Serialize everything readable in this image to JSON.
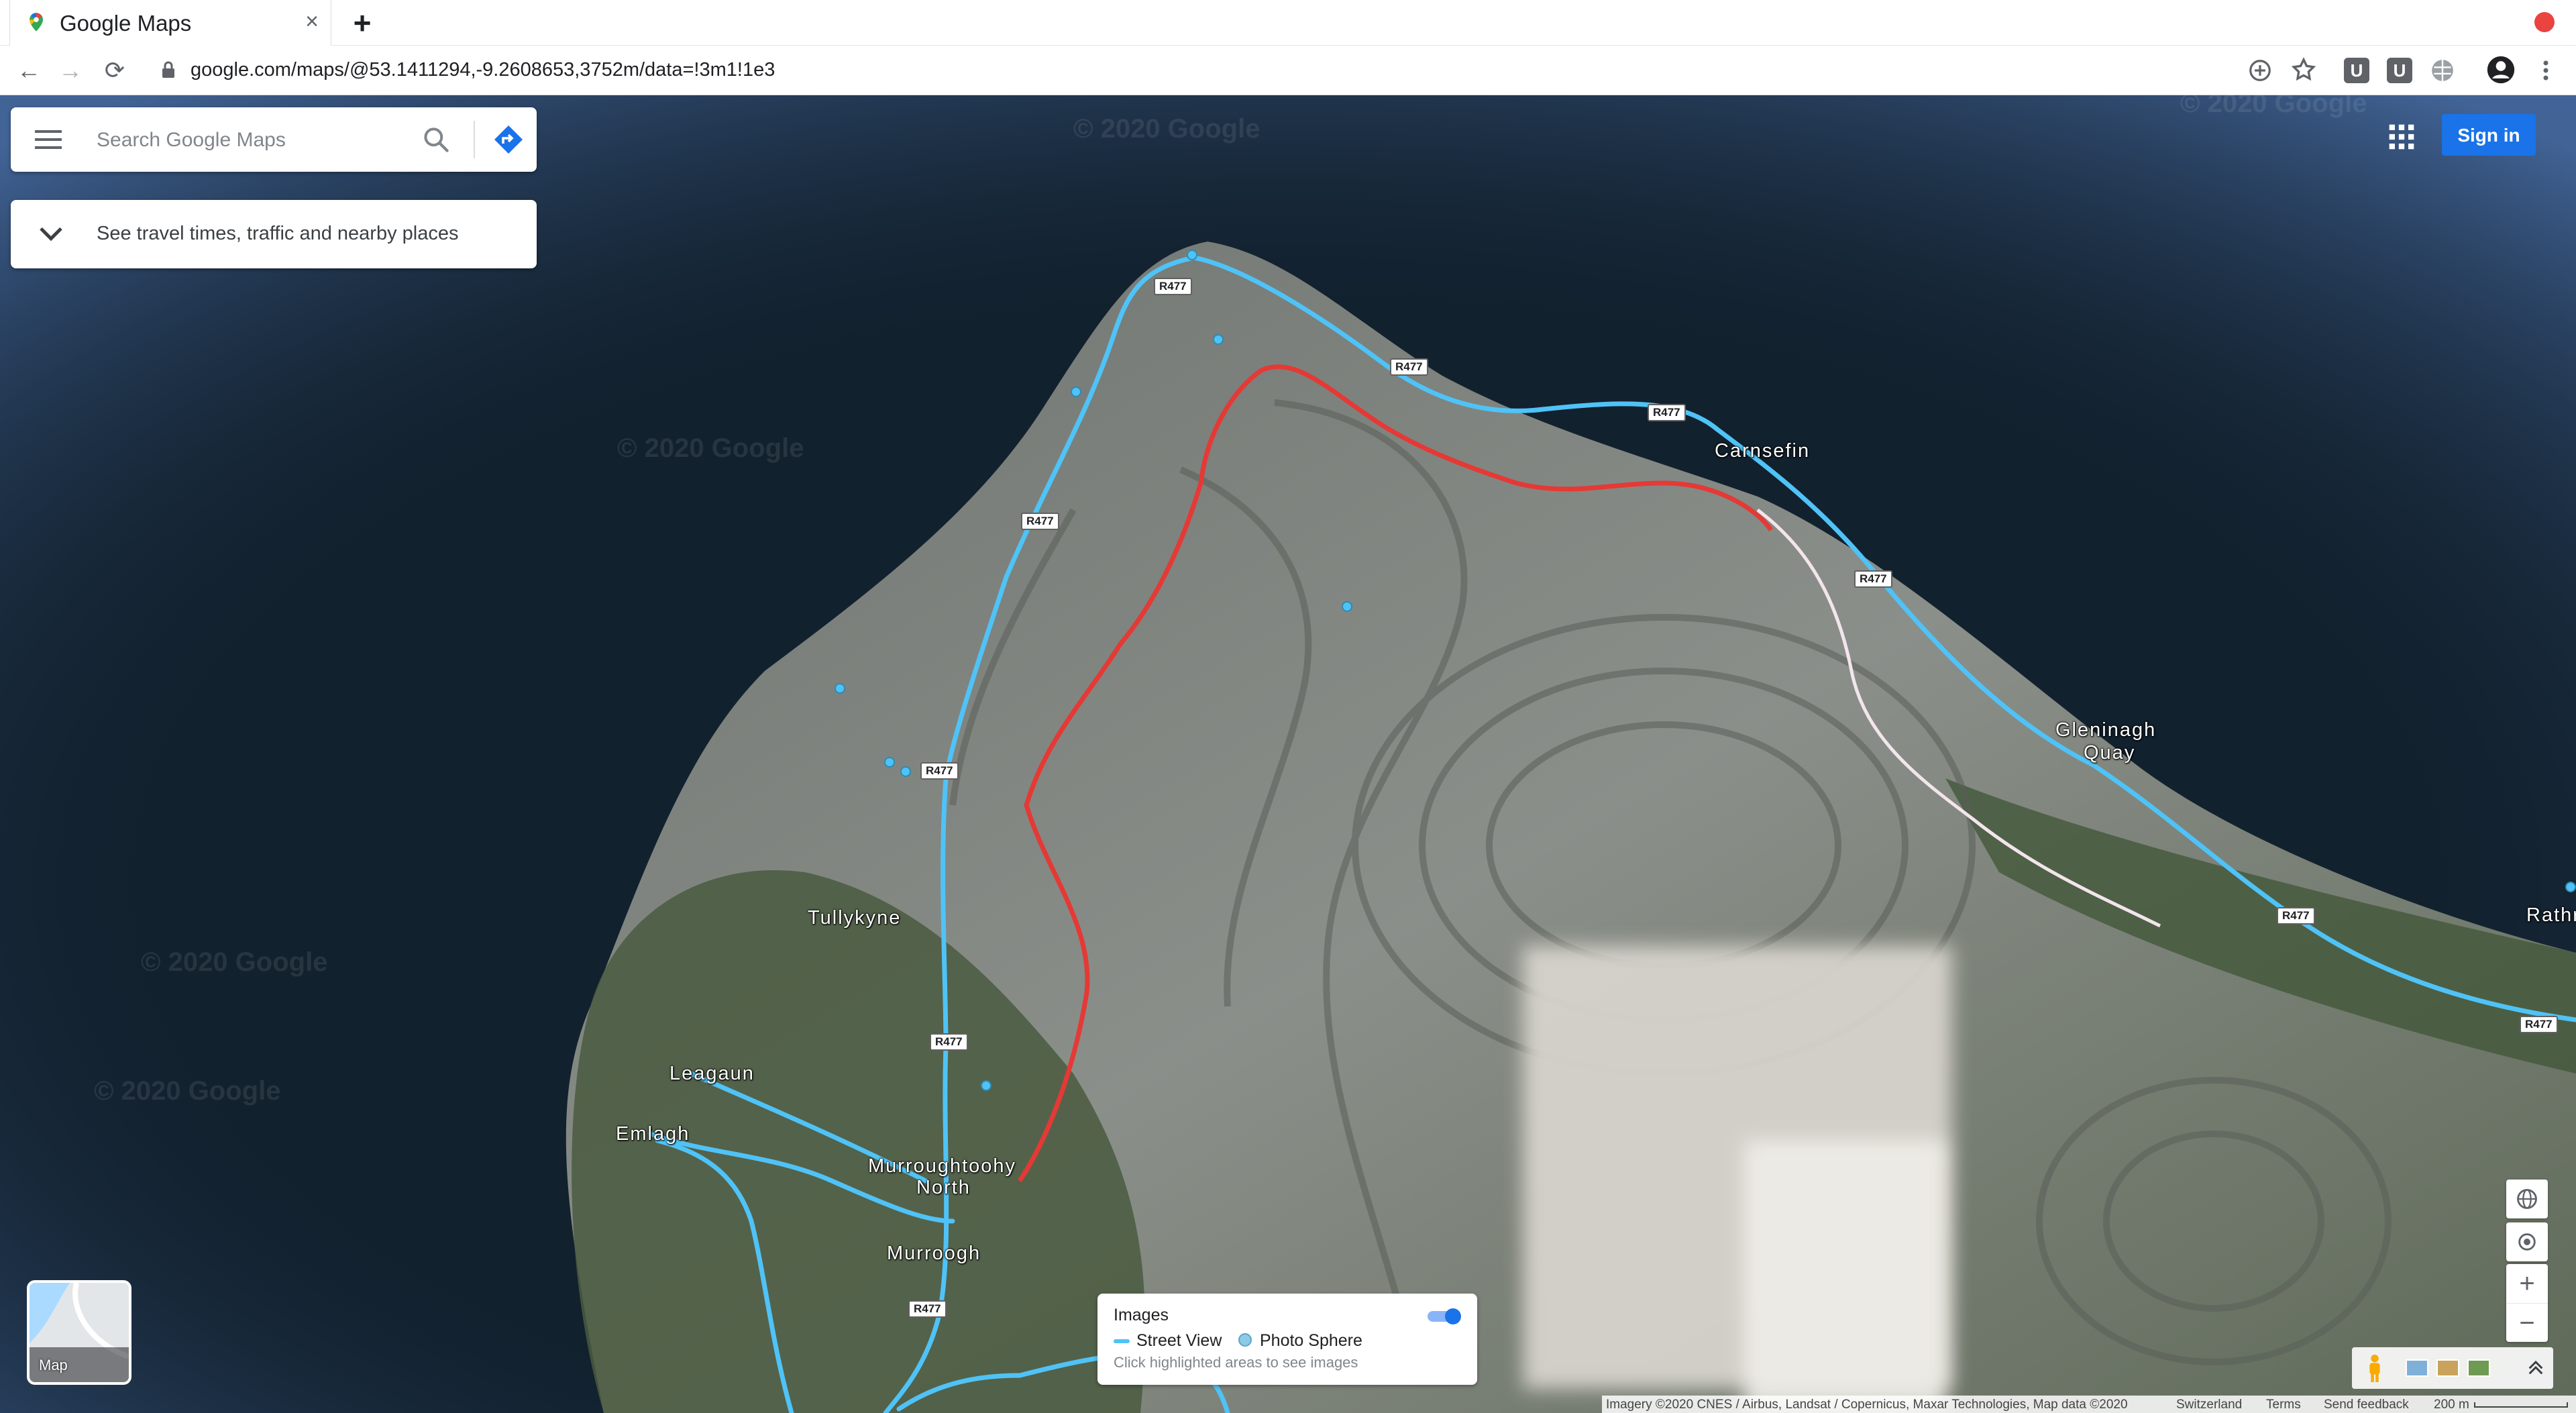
{
  "browser": {
    "tab_title": "Google Maps",
    "tab_close": "×",
    "new_tab": "+",
    "url": "google.com/maps/@53.1411294,-9.2608653,3752m/data=!3m1!1e3",
    "back": "←",
    "forward": "→",
    "reload": "⟳",
    "extensions": [
      "U",
      "U"
    ]
  },
  "search": {
    "placeholder": "Search Google Maps"
  },
  "explore": {
    "label": "See travel times, traffic and nearby places"
  },
  "header": {
    "signin_label": "Sign in"
  },
  "map": {
    "places": [
      "Carnsefin",
      "Gleninagh",
      "Quay",
      "Tullykyne",
      "Leagaun",
      "Emlagh",
      "Murroughtoohy",
      "North",
      "Murroogh",
      "Rathr"
    ],
    "road_label": "R477",
    "watermark": "© 2020 Google",
    "layer_label": "Map"
  },
  "images_panel": {
    "title": "Images",
    "street_view": "Street View",
    "photo_sphere": "Photo Sphere",
    "hint": "Click highlighted areas to see images",
    "toggle_on": true
  },
  "controls": {
    "zoom_in": "+",
    "zoom_out": "−"
  },
  "footer": {
    "imagery": "Imagery ©2020 CNES / Airbus, Landsat / Copernicus, Maxar Technologies, Map data ©2020",
    "country": "Switzerland",
    "terms": "Terms",
    "feedback": "Send feedback",
    "scale": "200 m"
  },
  "colors": {
    "street_view_line": "#4fc3f7",
    "route_red": "#e53935",
    "signin_blue": "#1a73e8",
    "sea": "#12212e"
  }
}
